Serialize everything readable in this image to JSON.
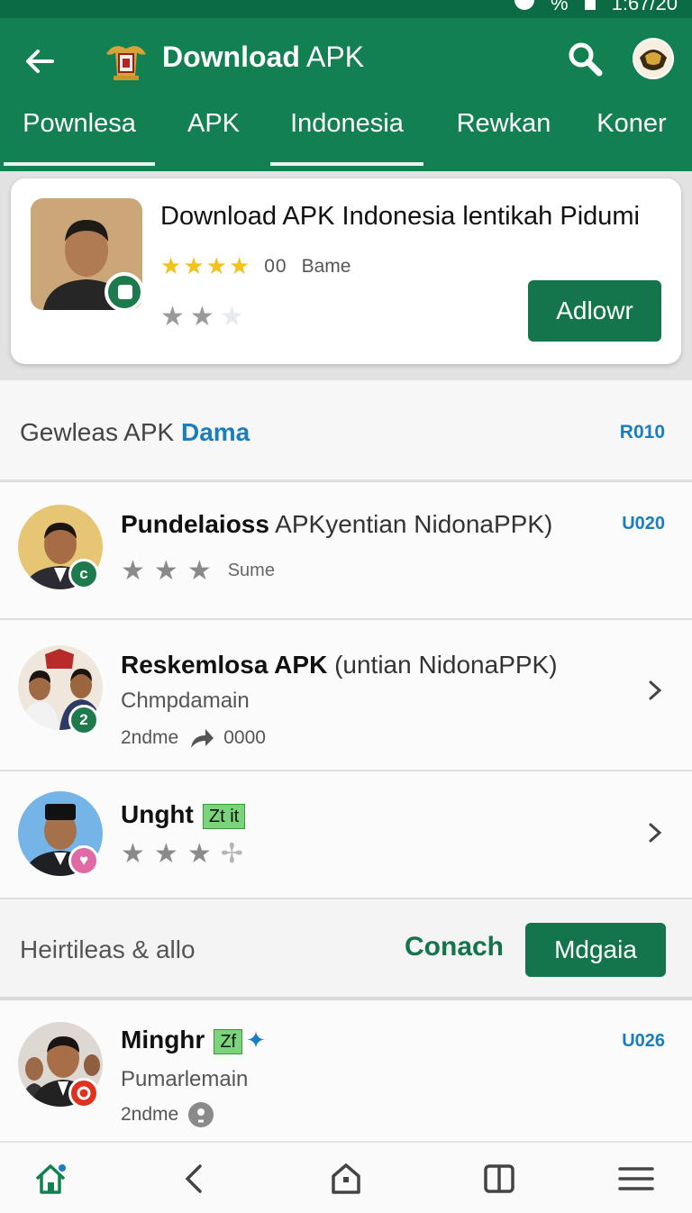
{
  "status_bar": {
    "battery": "%",
    "time": "1:67/20"
  },
  "header": {
    "title_bold": "Download",
    "title_rest": "APK"
  },
  "tabs": [
    "Pownlesa",
    "APK",
    "Indonesia",
    "Rewkan",
    "Koner"
  ],
  "featured": {
    "title": "Download APK Indonesia lentikah Pidumi",
    "rating_count": "00",
    "rating_label": "Bame",
    "button_label": "Adlowr"
  },
  "section": {
    "title_plain": "Gewleas APK ",
    "title_accent": "Dama",
    "code": "R010"
  },
  "list": [
    {
      "title_bold": "Pundelaioss",
      "title_rest": " APKyentian NidonaPPK)",
      "code": "U020",
      "badge": "c",
      "star_label": "Sume"
    },
    {
      "title_bold": "Reskemlosa APK",
      "title_rest": " (untian NidonaPPK)",
      "subtitle": "Chmpdamain",
      "meta_left": "2ndme",
      "meta_right": "0000",
      "badge": "2"
    },
    {
      "title_bold": "Unght",
      "tag": "Zt it",
      "badge": "♥"
    }
  ],
  "heritage": {
    "label": "Heirtileas & allo",
    "link": "Conach",
    "button": "Mdgaia"
  },
  "last_item": {
    "title_bold": "Minghr",
    "tag": "Zf",
    "tag_symbol": "✦",
    "code": "U026",
    "subtitle": "Pumarlemain",
    "meta": "2ndme"
  },
  "icons": {
    "back": "arrow-left-icon",
    "logo": "emblem-icon",
    "search": "search-icon",
    "profile": "profile-emblem-icon",
    "nav": [
      "home-icon",
      "back-chevron-icon",
      "home-pentagon-icon",
      "book-icon",
      "menu-icon"
    ]
  },
  "colors": {
    "primary": "#128050",
    "button": "#14754a",
    "accent": "#1a7dc0",
    "star": "#f4c21c"
  }
}
